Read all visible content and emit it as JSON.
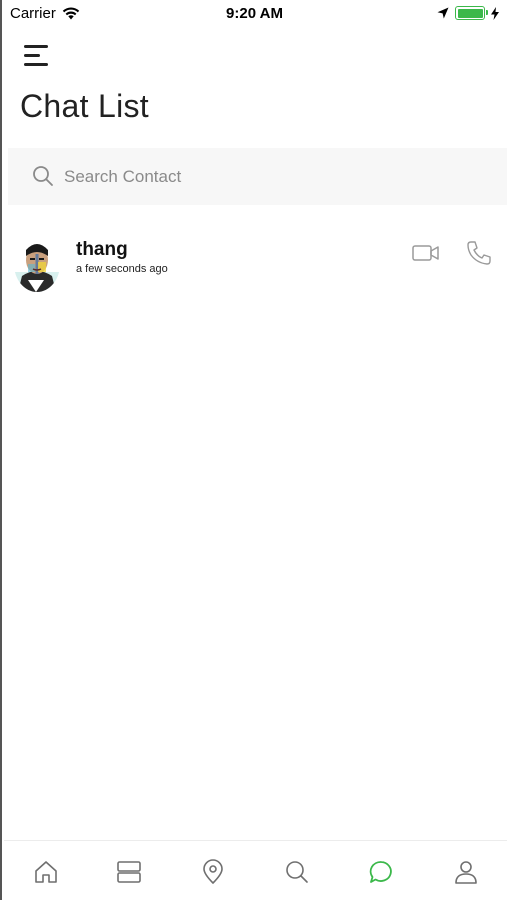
{
  "status_bar": {
    "carrier": "Carrier",
    "time": "9:20 AM",
    "battery_level": 1.0
  },
  "header": {
    "title": "Chat List"
  },
  "search": {
    "placeholder": "Search Contact",
    "value": ""
  },
  "chats": [
    {
      "name": "thang",
      "time": "a few seconds ago"
    }
  ],
  "tab_bar": {
    "tabs": [
      {
        "icon": "home-icon",
        "active": false
      },
      {
        "icon": "layers-icon",
        "active": false
      },
      {
        "icon": "location-pin-icon",
        "active": false
      },
      {
        "icon": "search-icon",
        "active": false
      },
      {
        "icon": "chat-bubble-icon",
        "active": true
      },
      {
        "icon": "profile-icon",
        "active": false
      }
    ]
  },
  "colors": {
    "accent": "#3bb84a",
    "icon_gray": "#9a9a9a",
    "search_bg": "#f7f7f7"
  }
}
